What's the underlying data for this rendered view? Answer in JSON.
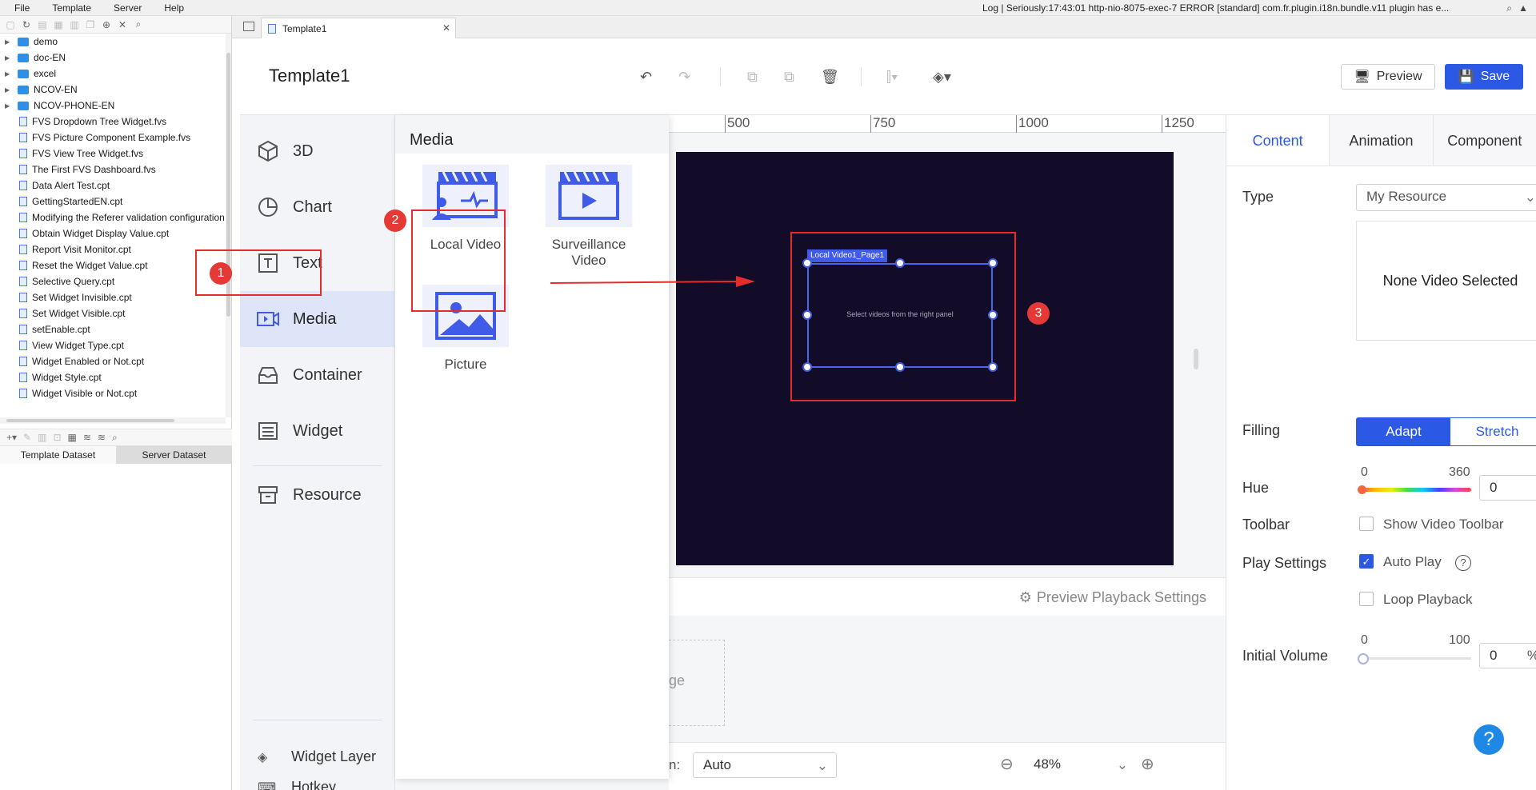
{
  "menubar": {
    "items": [
      "File",
      "Template",
      "Server",
      "Help"
    ],
    "log_text": "Log | Seriously:17:43:01 http-nio-8075-exec-7 ERROR [standard] com.fr.plugin.i18n.bundle.v11 plugin has e..."
  },
  "tree": {
    "items": [
      {
        "label": "demo",
        "kind": "folder"
      },
      {
        "label": "doc-EN",
        "kind": "folder"
      },
      {
        "label": "excel",
        "kind": "folder"
      },
      {
        "label": "NCOV-EN",
        "kind": "folder"
      },
      {
        "label": "NCOV-PHONE-EN",
        "kind": "folder"
      },
      {
        "label": "FVS Dropdown Tree Widget.fvs",
        "kind": "file"
      },
      {
        "label": "FVS Picture Component Example.fvs",
        "kind": "file"
      },
      {
        "label": "FVS View Tree Widget.fvs",
        "kind": "file"
      },
      {
        "label": "The First FVS Dashboard.fvs",
        "kind": "file"
      },
      {
        "label": "Data Alert Test.cpt",
        "kind": "file"
      },
      {
        "label": "GettingStartedEN.cpt",
        "kind": "file"
      },
      {
        "label": "Modifying the Referer validation configuration",
        "kind": "file"
      },
      {
        "label": "Obtain Widget Display Value.cpt",
        "kind": "file"
      },
      {
        "label": "Report Visit Monitor.cpt",
        "kind": "file"
      },
      {
        "label": "Reset the Widget Value.cpt",
        "kind": "file"
      },
      {
        "label": "Selective Query.cpt",
        "kind": "file"
      },
      {
        "label": "Set Widget Invisible.cpt",
        "kind": "file"
      },
      {
        "label": "Set Widget Visible.cpt",
        "kind": "file"
      },
      {
        "label": "setEnable.cpt",
        "kind": "file"
      },
      {
        "label": "View Widget Type.cpt",
        "kind": "file"
      },
      {
        "label": "Widget Enabled or Not.cpt",
        "kind": "file"
      },
      {
        "label": "Widget Style.cpt",
        "kind": "file"
      },
      {
        "label": "Widget Visible or Not.cpt",
        "kind": "file"
      }
    ]
  },
  "dataset_tabs": [
    "Template Dataset",
    "Server Dataset"
  ],
  "tab": {
    "label": "Template1"
  },
  "editor": {
    "title": "Template1",
    "preview_label": "Preview",
    "save_label": "Save"
  },
  "categories": [
    {
      "label": "3D",
      "icon": "cube-icon"
    },
    {
      "label": "Chart",
      "icon": "pie-chart-icon"
    },
    {
      "label": "Text",
      "icon": "text-icon"
    },
    {
      "label": "Media",
      "icon": "media-icon"
    },
    {
      "label": "Container",
      "icon": "container-icon"
    },
    {
      "label": "Widget",
      "icon": "widget-icon"
    },
    {
      "label": "Resource",
      "icon": "resource-icon"
    }
  ],
  "footer_items": [
    {
      "label": "Widget Layer",
      "icon": "layers-icon"
    },
    {
      "label": "Hotkey",
      "icon": "keyboard-icon"
    }
  ],
  "flyout": {
    "title": "Media",
    "tiles": [
      "Local Video",
      "Surveillance Video",
      "Picture"
    ]
  },
  "ruler": {
    "labels": [
      "500",
      "750",
      "1000",
      "1250"
    ]
  },
  "canvas": {
    "selection_tag": "Local Video1_Page1",
    "hint": "Select videos from the right panel"
  },
  "badges": [
    "1",
    "2",
    "3"
  ],
  "canvas_bottom": {
    "playback_label": "Preview Playback Settings",
    "background_fragment": "ge"
  },
  "statusbar": {
    "fit_label_fragment": "n:",
    "fit_value": "Auto",
    "zoom_value": "48%"
  },
  "props": {
    "tabs": [
      "Content",
      "Animation",
      "Component"
    ],
    "type_label": "Type",
    "type_value": "My Resource",
    "none_selected": "None Video Selected",
    "filling_label": "Filling",
    "filling_options": [
      "Adapt",
      "Stretch"
    ],
    "hue_label": "Hue",
    "hue_min": "0",
    "hue_max": "360",
    "hue_value": "0",
    "toolbar_label": "Toolbar",
    "toolbar_option": "Show Video Toolbar",
    "play_label": "Play Settings",
    "autoplay_option": "Auto Play",
    "loop_option": "Loop Playback",
    "volume_label": "Initial Volume",
    "volume_min": "0",
    "volume_max": "100",
    "volume_value": "0",
    "volume_unit": "%"
  },
  "accent_color": "#2b59e6",
  "highlight_color": "#e53935"
}
